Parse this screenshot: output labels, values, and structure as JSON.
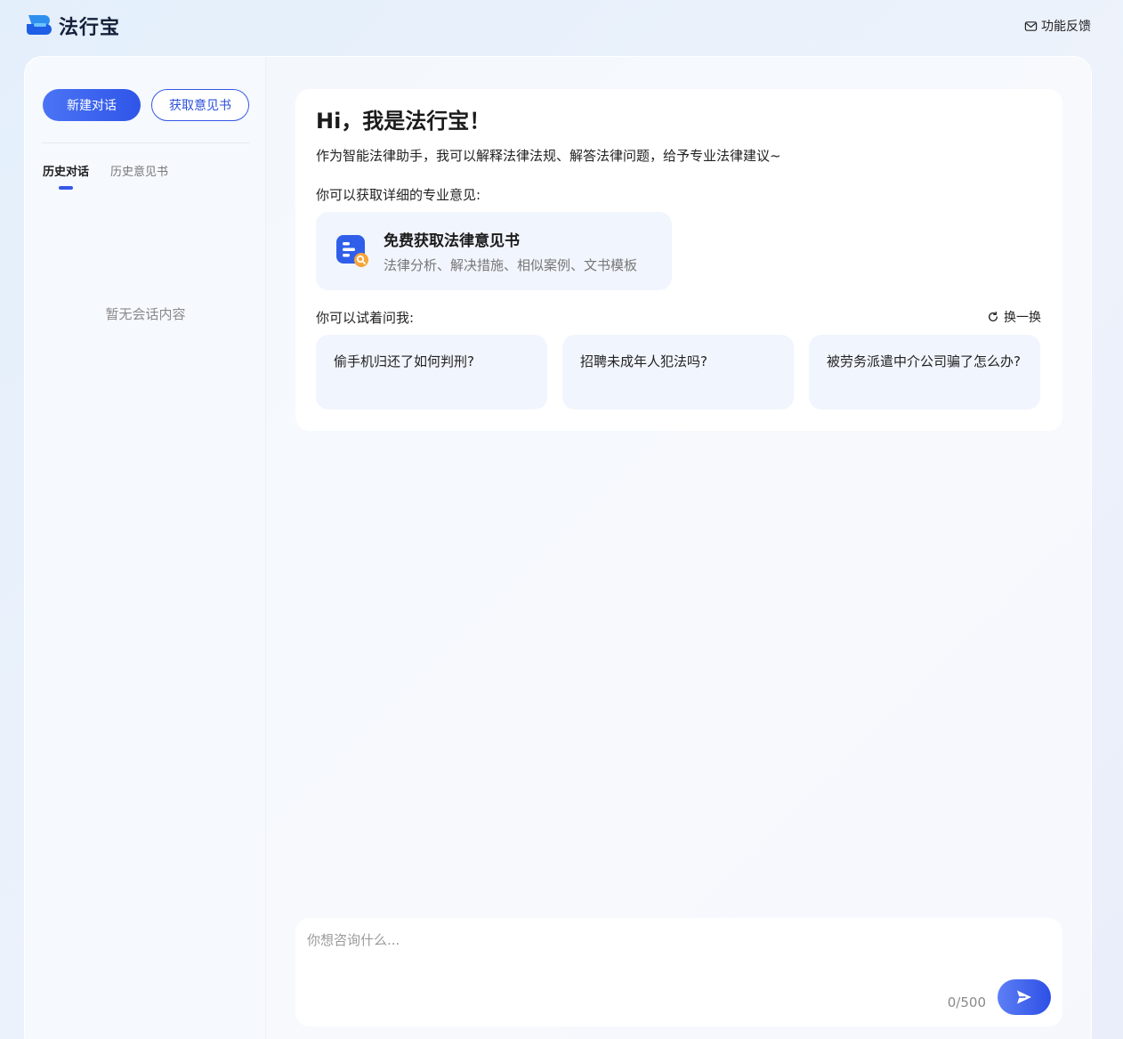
{
  "app": {
    "name": "法行宝"
  },
  "header": {
    "feedback_label": "功能反馈"
  },
  "sidebar": {
    "new_chat_label": "新建对话",
    "get_opinion_label": "获取意见书",
    "tabs": [
      {
        "label": "历史对话",
        "active": true
      },
      {
        "label": "历史意见书",
        "active": false
      }
    ],
    "empty_text": "暂无会话内容"
  },
  "welcome": {
    "greeting": "Hi，我是法行宝！",
    "intro": "作为智能法律助手，我可以解释法律法规、解答法律问题，给予专业法律建议~",
    "opinion_prompt": "你可以获取详细的专业意见:",
    "opinion_card": {
      "title": "免费获取法律意见书",
      "subtitle": "法律分析、解决措施、相似案例、文书模板"
    },
    "ask_prompt": "你可以试着问我:",
    "refresh_label": "换一换",
    "questions": [
      "偷手机归还了如何判刑?",
      "招聘未成年人犯法吗?",
      "被劳务派遣中介公司骗了怎么办?"
    ]
  },
  "composer": {
    "placeholder": "你想咨询什么...",
    "value": "",
    "counter": "0/500"
  },
  "colors": {
    "accent": "#3558e6",
    "card_bg": "#f1f5fd"
  },
  "icons": [
    "logo-icon",
    "mail-icon",
    "document-search-icon",
    "refresh-icon",
    "send-icon"
  ]
}
